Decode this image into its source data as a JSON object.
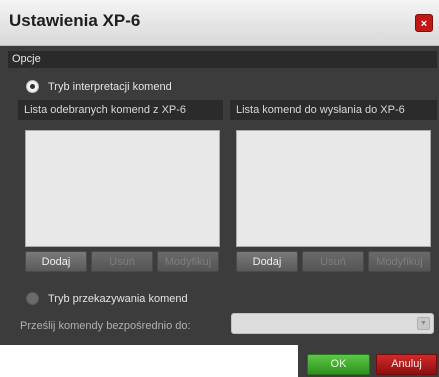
{
  "dialog": {
    "title": "Ustawienia XP-6",
    "close_label": "×"
  },
  "options": {
    "section_label": "Opcje",
    "mode_interpret": {
      "label": "Tryb interpretacji komend",
      "selected": true
    },
    "mode_forward": {
      "label": "Tryb przekazywania komend",
      "selected": false
    }
  },
  "received_list": {
    "header": "Lista odebranych komend z XP-6",
    "buttons": {
      "add": "Dodaj",
      "remove": "Usuń",
      "modify": "Modyfikuj"
    }
  },
  "send_list": {
    "header": "Lista komend do wysłania do XP-6",
    "buttons": {
      "add": "Dodaj",
      "remove": "Usuń",
      "modify": "Modyfikuj"
    }
  },
  "forward": {
    "label": "Prześlij komendy bezpośrednio do:",
    "selected_value": ""
  },
  "footer": {
    "ok_label": "OK",
    "cancel_label": "Anuluj"
  },
  "colors": {
    "ok": "#3fa62c",
    "cancel": "#b51d1d",
    "close": "#c01717",
    "panel": "#3c3c3c"
  }
}
